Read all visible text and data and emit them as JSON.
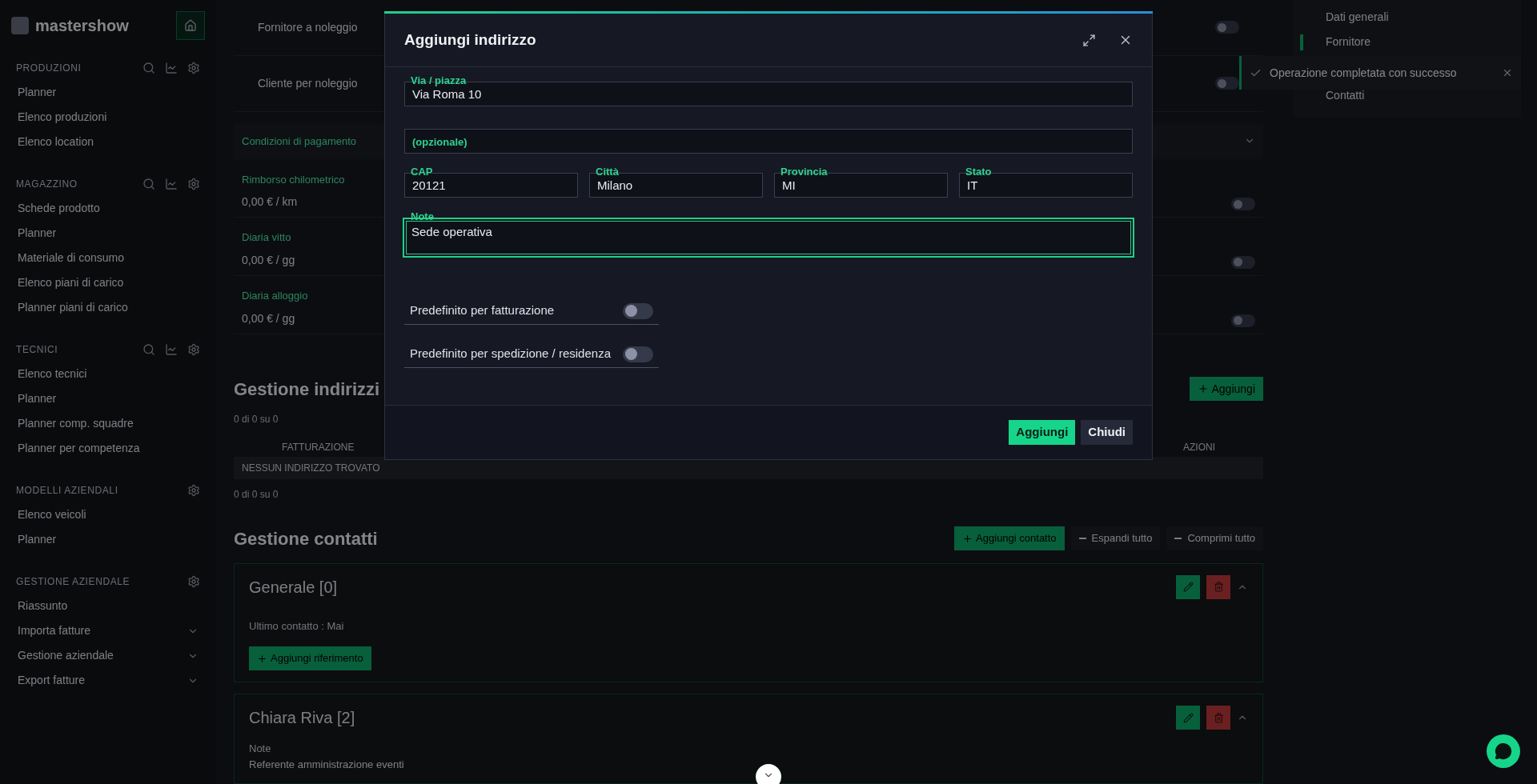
{
  "sidebar": {
    "logo": "mastershow",
    "sections": [
      {
        "title": "PRODUZIONI",
        "tools": true,
        "items": [
          {
            "label": "Planner"
          },
          {
            "label": "Elenco produzioni"
          },
          {
            "label": "Elenco location"
          }
        ]
      },
      {
        "title": "MAGAZZINO",
        "tools": true,
        "items": [
          {
            "label": "Schede prodotto"
          },
          {
            "label": "Planner"
          },
          {
            "label": "Materiale di consumo"
          },
          {
            "label": "Elenco piani di carico"
          },
          {
            "label": "Planner piani di carico"
          }
        ]
      },
      {
        "title": "TECNICI",
        "tools": true,
        "items": [
          {
            "label": "Elenco tecnici"
          },
          {
            "label": "Planner"
          },
          {
            "label": "Planner comp. squadre"
          },
          {
            "label": "Planner per competenza"
          }
        ]
      },
      {
        "title": "MODELLI AZIENDALI",
        "tools": false,
        "items": [
          {
            "label": "Elenco veicoli"
          },
          {
            "label": "Planner"
          }
        ]
      },
      {
        "title": "GESTIONE AZIENDALE",
        "tools": false,
        "items": [
          {
            "label": "Riassunto",
            "expandable": false
          },
          {
            "label": "Importa fatture",
            "expandable": true
          },
          {
            "label": "Gestione aziendale",
            "expandable": true
          },
          {
            "label": "Export fatture",
            "expandable": true
          }
        ]
      }
    ]
  },
  "main": {
    "flags": [
      {
        "label": "Fornitore a noleggio",
        "on": false
      },
      {
        "label": "Cliente per noleggio",
        "on": false
      }
    ],
    "payment": {
      "label": "Condizioni di pagamento"
    },
    "rates": [
      {
        "label": "Rimborso chilometrico",
        "value": "0,00 € / km",
        "on": false
      },
      {
        "label": "Diaria vitto",
        "value": "0,00 € / gg",
        "on": false
      },
      {
        "label": "Diaria alloggio",
        "value": "0,00 € / gg",
        "on": false
      }
    ],
    "addresses": {
      "title": "Gestione indirizzi",
      "add_button": "Aggiungi",
      "count_top": "0 di 0 su 0",
      "columns": [
        "FATTURAZIONE",
        "AZIONI"
      ],
      "empty": "NESSUN INDIRIZZO TROVATO",
      "count_bottom": "0 di 0 su 0"
    },
    "contacts": {
      "title": "Gestione contatti",
      "buttons": [
        {
          "label": "Aggiungi contatto",
          "kind": "primary"
        },
        {
          "label": "Espandi tutto",
          "kind": "plain"
        },
        {
          "label": "Comprimi tutto",
          "kind": "plain"
        }
      ],
      "cards": [
        {
          "title": "Generale [0]",
          "last_contact": "Ultimo contatto : Mai",
          "add_reference": "Aggiungi riferimento"
        },
        {
          "title": "Chiara Riva [2]",
          "note_label": "Note",
          "note": "Referente amministrazione eventi"
        }
      ]
    }
  },
  "right_panel": {
    "items": [
      {
        "label": "Dati generali",
        "selected": false
      },
      {
        "label": "Fornitore",
        "selected": true
      },
      {
        "label": "Contatti",
        "selected": false
      }
    ]
  },
  "toast": {
    "message": "Operazione completata con successo"
  },
  "modal": {
    "title": "Aggiungi indirizzo",
    "street": {
      "label": "Via / piazza",
      "value": "Via Roma 10"
    },
    "street_extra": {
      "placeholder": "(opzionale)"
    },
    "row": [
      {
        "label": "CAP",
        "value": "20121"
      },
      {
        "label": "Città",
        "value": "Milano"
      },
      {
        "label": "Provincia",
        "value": "MI"
      },
      {
        "label": "Stato",
        "value": "IT"
      }
    ],
    "note": {
      "label": "Note",
      "value": "Sede operativa",
      "focused": true
    },
    "toggles": [
      {
        "label": "Predefinito per fatturazione",
        "on": false
      },
      {
        "label": "Predefinito per spedizione / residenza",
        "on": false
      }
    ],
    "buttons": [
      {
        "label": "Aggiungi",
        "kind": "primary"
      },
      {
        "label": "Chiudi",
        "kind": "secondary"
      }
    ]
  }
}
